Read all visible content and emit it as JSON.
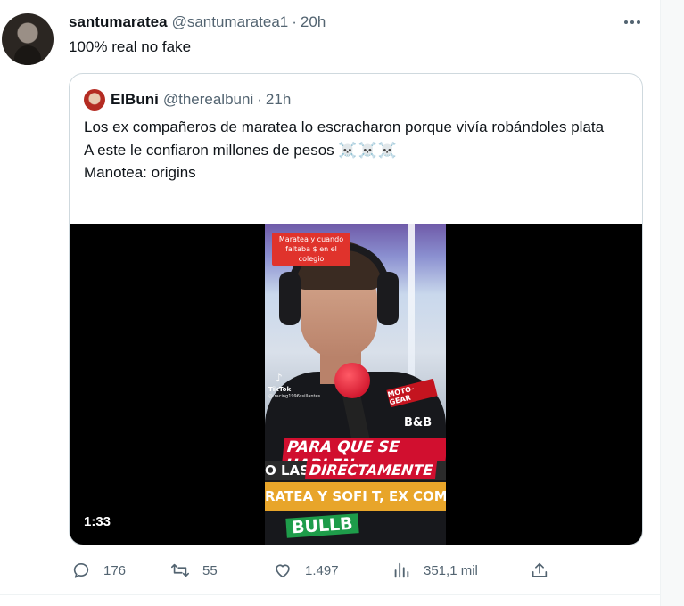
{
  "tweet": {
    "author_name": "santumaratea",
    "author_handle": "@santumaratea1",
    "separator": "·",
    "time": "20h",
    "text": "100% real no fake"
  },
  "quoted": {
    "author_name": "ElBuni",
    "author_handle": "@therealbuni",
    "time": "21h",
    "lines": [
      "Los ex compañeros de maratea lo escracharon porque vivía robándoles plata",
      "A este le confiaron millones de pesos",
      "Manotea: origins"
    ],
    "skulls": "☠️☠️☠️",
    "video": {
      "duration": "1:33",
      "sticker": "Maratea y cuando faltaba $ en el colegio",
      "tiktok_logo": "♪",
      "tiktok_label": "TikTok",
      "tiktok_user": "@ racing1996ssillantes",
      "patch": "MOTO-GEAR",
      "sponsor": "B&B",
      "caption1": "PARA QUE SE HABLEN",
      "caption_left": "O LAS",
      "caption2": "DIRECTAMENTE",
      "caption3": "RATEA Y SOFI T, EX COMPA",
      "jersey": "BULLB"
    }
  },
  "actions": {
    "replies": "176",
    "retweets": "55",
    "likes": "1.497",
    "views": "351,1 mil"
  },
  "colors": {
    "text": "#0f1419",
    "muted": "#536471",
    "border": "#cfd9de"
  },
  "icons": [
    "more-icon",
    "reply-icon",
    "retweet-icon",
    "like-icon",
    "views-icon",
    "share-icon"
  ]
}
